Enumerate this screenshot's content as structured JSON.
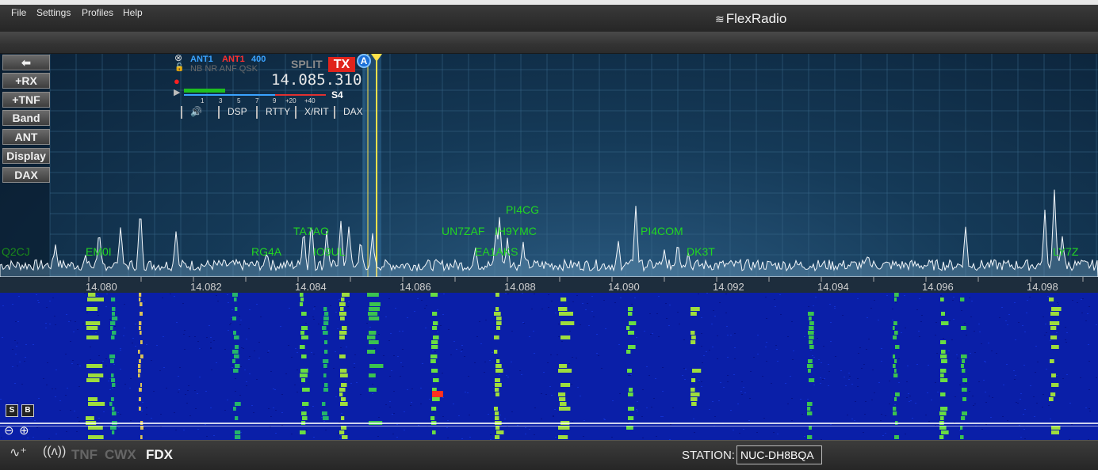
{
  "menu": {
    "file": "File",
    "settings": "Settings",
    "profiles": "Profiles",
    "help": "Help"
  },
  "brand": "FlexRadio",
  "side_buttons": {
    "back": "⬅",
    "rx": "+RX",
    "tnf": "+TNF",
    "band": "Band",
    "ant": "ANT",
    "display": "Display",
    "dax": "DAX"
  },
  "slice": {
    "rx_ant": "ANT1",
    "tx_ant": "ANT1",
    "filter": "400",
    "flags": "NB NR ANF QSK",
    "split": "SPLIT",
    "tx": "TX",
    "letter": "A",
    "frequency": "14.085.310",
    "smeter": "S4",
    "meter_ticks": [
      "1",
      "3",
      "5",
      "7",
      "9",
      "+20",
      "+40"
    ],
    "tabs": [
      "🔊",
      "DSP",
      "RTTY",
      "X/RIT",
      "DAX"
    ]
  },
  "scale": [
    "14.080",
    "14.082",
    "14.084",
    "14.086",
    "14.088",
    "14.090",
    "14.092",
    "14.094",
    "14.096",
    "14.098"
  ],
  "spots": [
    {
      "call": "Q2CJ"
    },
    {
      "call": "EM0I"
    },
    {
      "call": "RG4A"
    },
    {
      "call": "TA7AO"
    },
    {
      "call": "IO9UL"
    },
    {
      "call": "UN7ZAF"
    },
    {
      "call": "IH9YMC"
    },
    {
      "call": "PI4CG"
    },
    {
      "call": "EA1AKS"
    },
    {
      "call": "PI4COM"
    },
    {
      "call": "DK3T"
    },
    {
      "call": "LY7Z"
    }
  ],
  "waterfall_buttons": {
    "s": "S",
    "b": "B"
  },
  "status": {
    "tnf": "TNF",
    "cwx": "CWX",
    "fdx": "FDX",
    "station_label": "STATION:",
    "station_value": "NUC-DH8BQA"
  },
  "colors": {
    "spot": "#22d622",
    "tx": "#e0241c",
    "slice": "#1b6fd6",
    "waterfall": "#0a1fa8"
  }
}
